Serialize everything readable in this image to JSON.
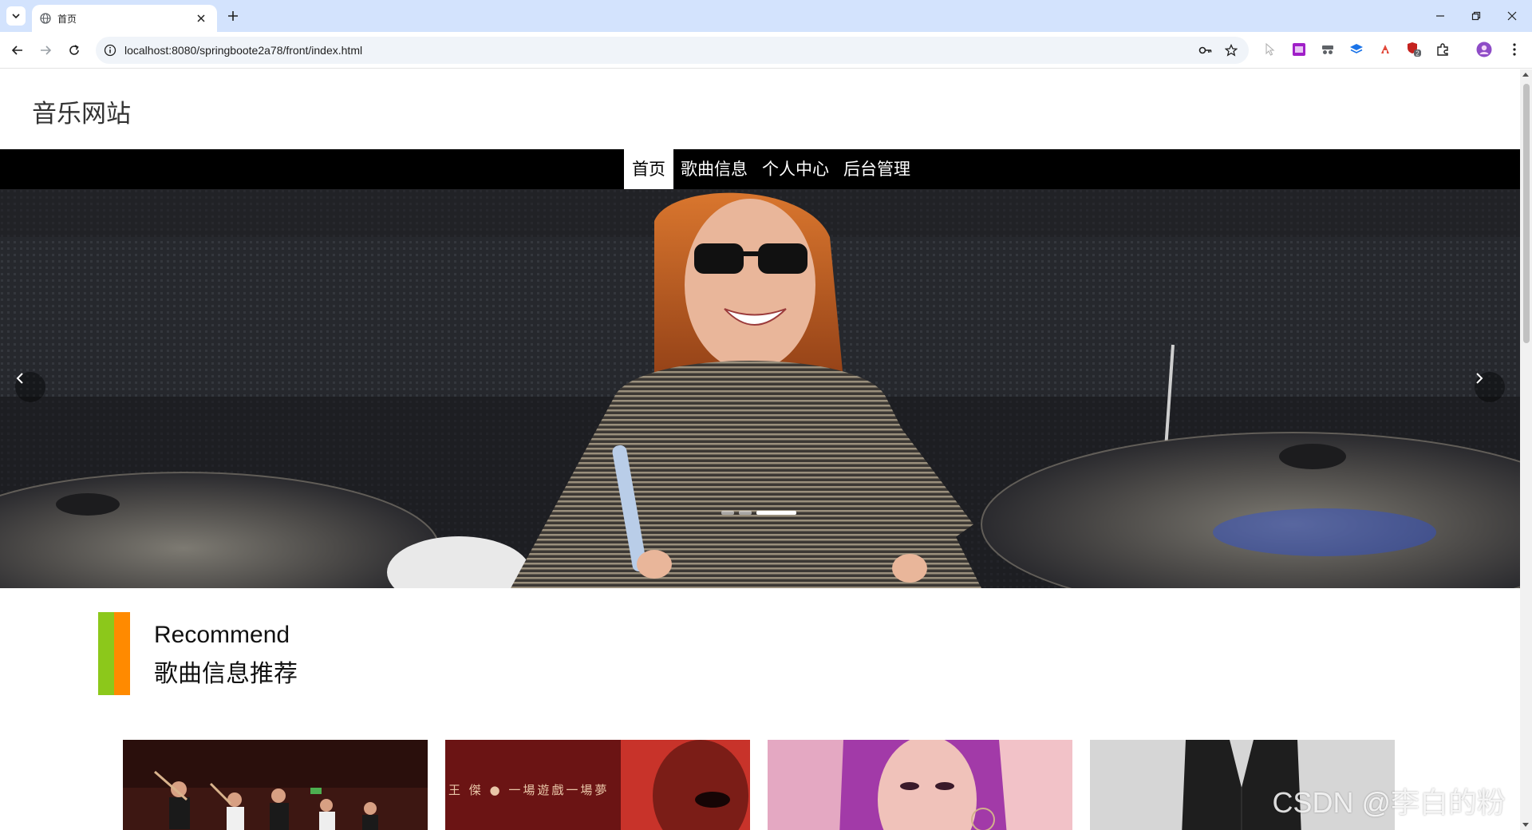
{
  "browser": {
    "tab_title": "首页",
    "url": "localhost:8080/springboote2a78/front/index.html",
    "extension_badge": "2"
  },
  "site": {
    "title": "音乐网站",
    "nav": [
      {
        "label": "首页",
        "active": true
      },
      {
        "label": "歌曲信息",
        "active": false
      },
      {
        "label": "个人中心",
        "active": false
      },
      {
        "label": "后台管理",
        "active": false
      }
    ]
  },
  "banner": {
    "slide_count": 3,
    "active_slide": 3
  },
  "recommend": {
    "title_en": "Recommend",
    "title_cn": "歌曲信息推荐",
    "accent_colors": [
      "#8cc81b",
      "#ff8a00"
    ]
  },
  "cards": [
    {
      "name": "card-1",
      "cover_text": ""
    },
    {
      "name": "card-2",
      "cover_text": "王 傑 ● 一場遊戲一場夢"
    },
    {
      "name": "card-3",
      "cover_text": ""
    },
    {
      "name": "card-4",
      "cover_text": ""
    }
  ],
  "watermark": "CSDN @李白的粉"
}
